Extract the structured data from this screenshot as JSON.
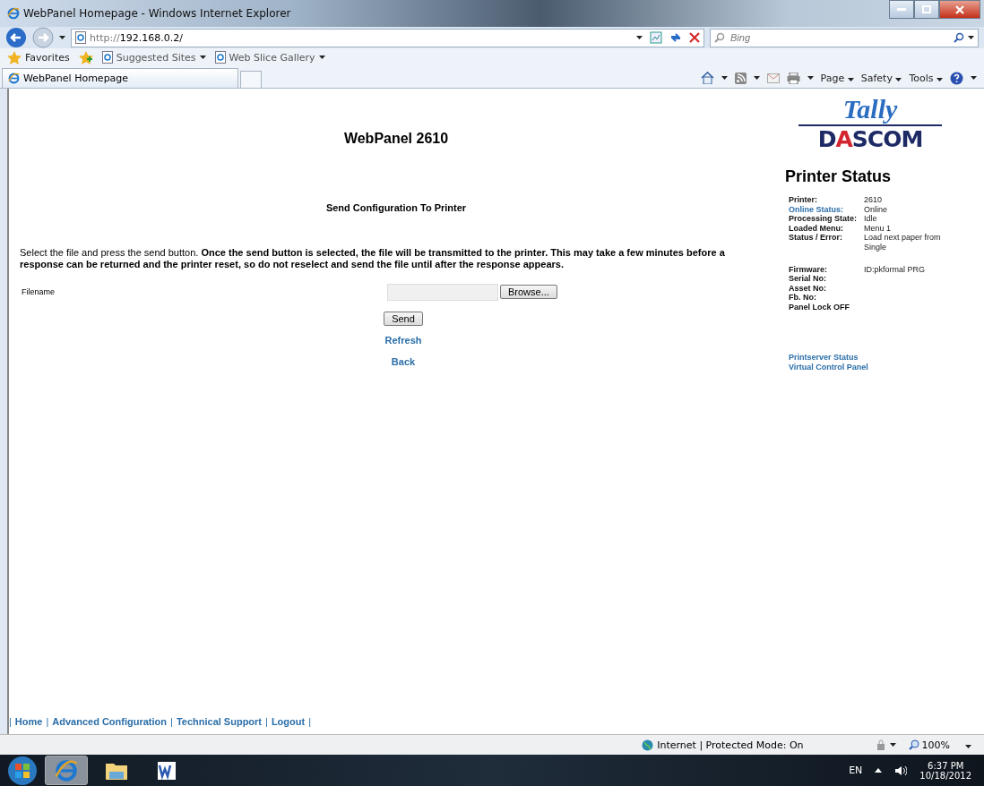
{
  "window": {
    "title": "WebPanel Homepage - Windows Internet Explorer"
  },
  "address_bar": {
    "url_prefix": "http://",
    "url_host": "192.168.0.2/",
    "search_placeholder": "Bing"
  },
  "favorites_bar": {
    "favorites": "Favorites",
    "items": [
      "Suggested Sites",
      "Web Slice Gallery"
    ]
  },
  "tabs": [
    {
      "label": "WebPanel Homepage",
      "selected": true
    }
  ],
  "command_bar": {
    "menus": [
      "Page",
      "Safety",
      "Tools"
    ]
  },
  "page": {
    "heading": "WebPanel 2610",
    "section_title": "Send Configuration To Printer",
    "description": "Select the file and press the send button. **Once the send button is selected, the file will be transmitted to the printer. This may take a few minutes before a response can be returned and the printer reset, so do not reselect and send the file until after the response appears.**",
    "filename_label": "Filename",
    "browse_button": "Browse...",
    "send_button": "Send",
    "links": [
      "Refresh",
      "Back"
    ]
  },
  "sidebar": {
    "logo": {
      "top": "Tally",
      "bottom": [
        {
          "text": "D",
          "color": "#1e2a66"
        },
        {
          "text": "A",
          "color": "#d22630"
        },
        {
          "text": "SCOM",
          "color": "#1e2a66"
        }
      ]
    },
    "title": "Printer Status",
    "status_groups": [
      [
        {
          "label": "Printer:",
          "value": "2610",
          "kind": "plain"
        },
        {
          "label": "Online Status:",
          "value": "Online",
          "kind": "link"
        },
        {
          "label": "Processing State:",
          "value": "Idle",
          "kind": "plain"
        },
        {
          "label": "Loaded Menu:",
          "value": "Menu 1",
          "kind": "plain"
        },
        {
          "label": "Status / Error:",
          "value": "Load next paper from Single",
          "kind": "plain"
        }
      ],
      [
        {
          "label": "Firmware:",
          "value": "ID:pkformal PRG",
          "kind": "plain"
        },
        {
          "label": "Serial No:",
          "kind": "plain"
        },
        {
          "label": "Asset No:",
          "kind": "plain"
        },
        {
          "label": "Fb. No:",
          "kind": "plain"
        },
        {
          "label": "Panel Lock OFF",
          "kind": "plain"
        }
      ]
    ],
    "links": [
      "Printserver Status",
      "Virtual Control Panel"
    ]
  },
  "footer": [
    {
      "kind": "separator",
      "text": "|"
    },
    {
      "kind": "link",
      "text": "Home"
    },
    {
      "kind": "separator",
      "text": "|"
    },
    {
      "kind": "link",
      "text": "Advanced Configuration"
    },
    {
      "kind": "separator",
      "text": "|"
    },
    {
      "kind": "link",
      "text": "Technical Support"
    },
    {
      "kind": "separator",
      "text": "|"
    },
    {
      "kind": "link",
      "text": "Logout"
    },
    {
      "kind": "separator",
      "text": "|"
    }
  ],
  "status_bar": {
    "zone": "Internet | Protected Mode: On",
    "zoom": "100%"
  },
  "taskbar": {
    "language": "EN",
    "time": "6:37 PM",
    "date": "10/18/2012"
  }
}
